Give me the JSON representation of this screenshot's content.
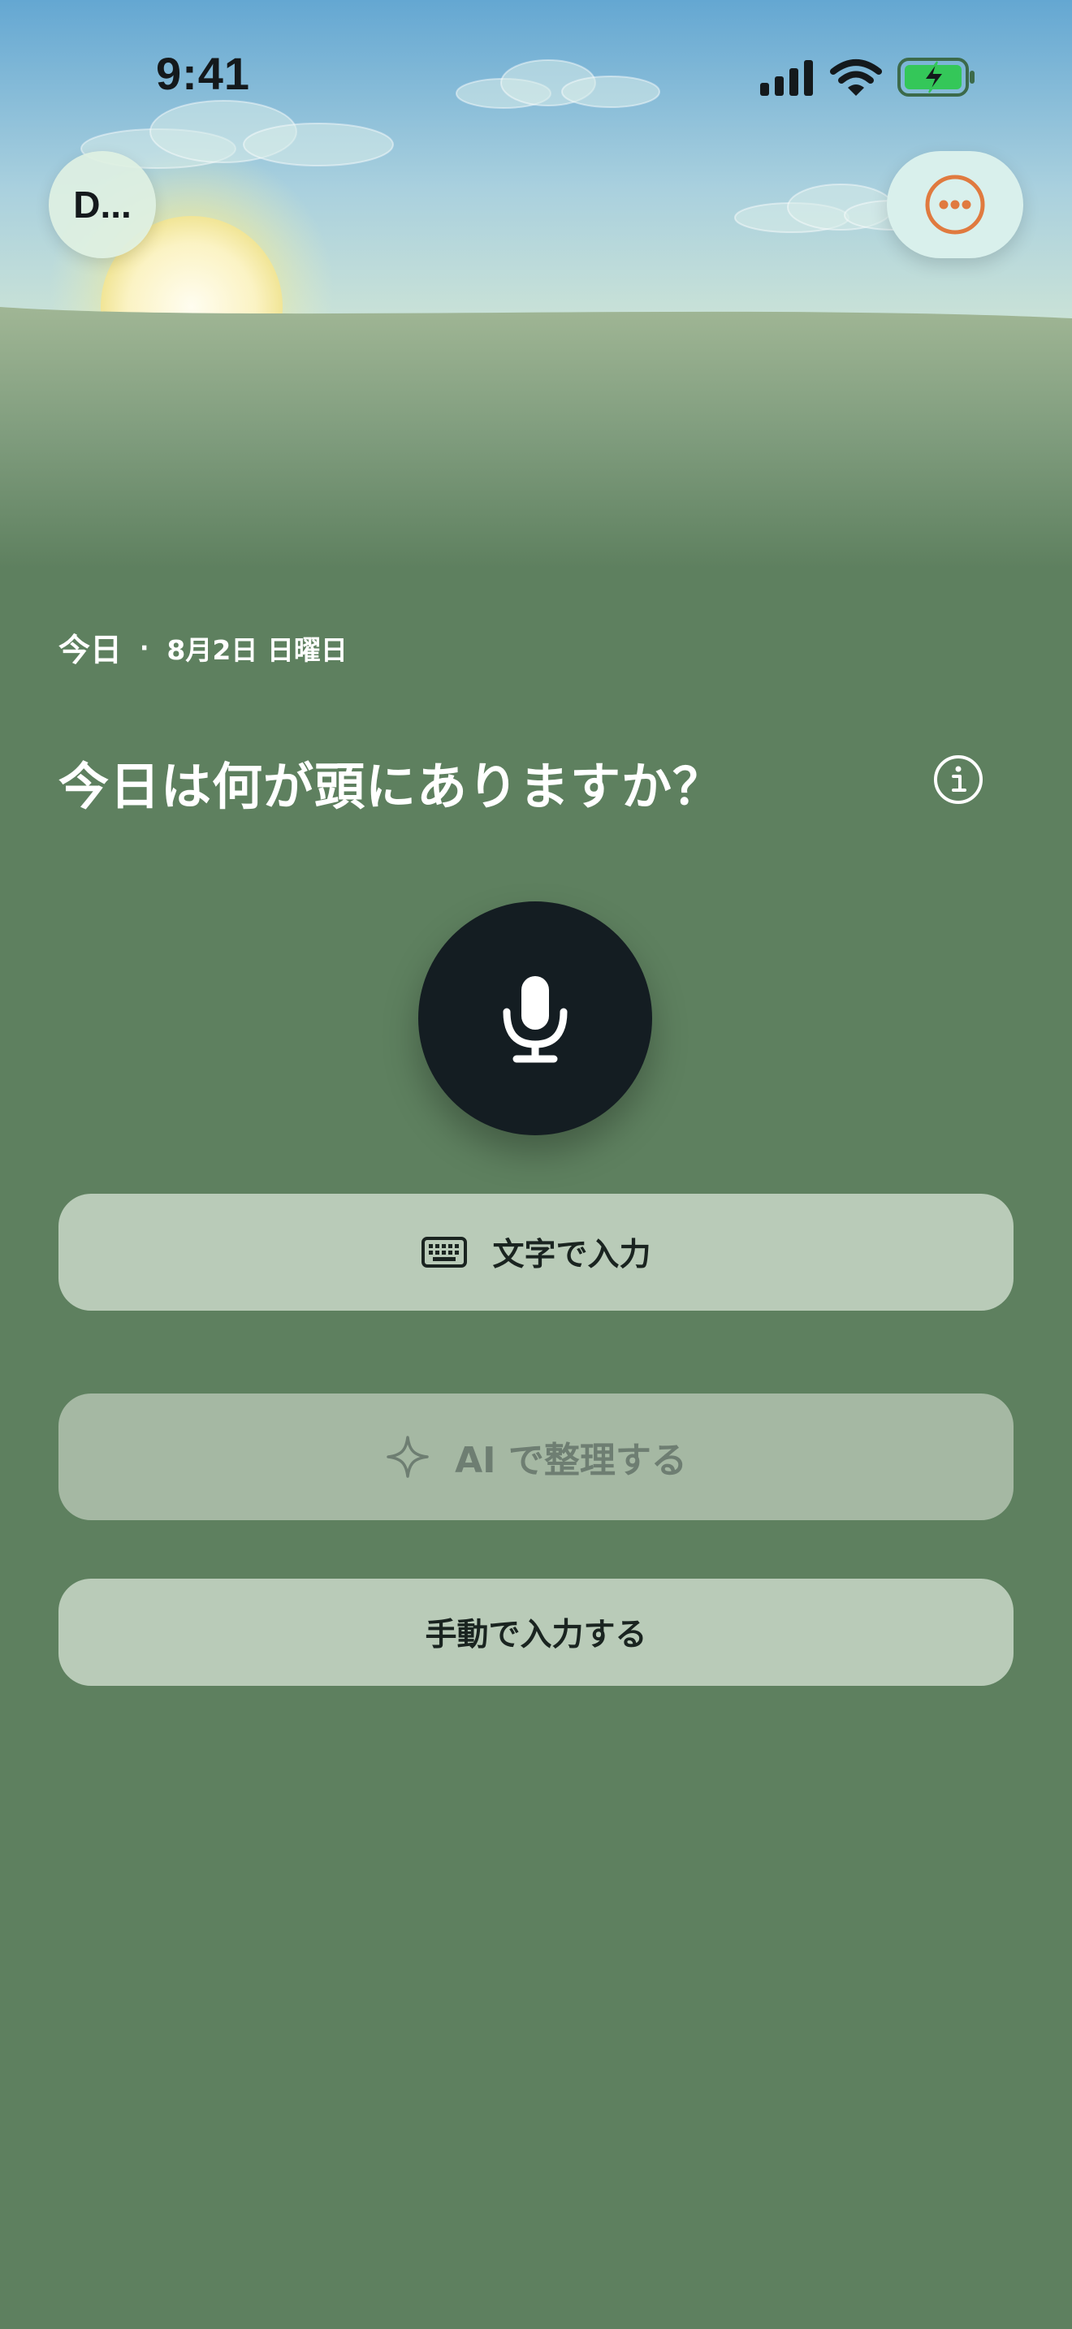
{
  "status_bar": {
    "time": "9:41",
    "icons": [
      "cellular-signal-icon",
      "wifi-icon",
      "battery-charging-icon"
    ],
    "battery_color": "#34c759"
  },
  "header": {
    "avatar_label": "D...",
    "more_icon": "ellipsis-circle-icon",
    "more_icon_color": "#e07a3f"
  },
  "date": {
    "today_label": "今日",
    "separator": "·",
    "full_date": "8月2日 日曜日"
  },
  "prompt": {
    "title": "今日は何が頭にありますか？",
    "info_icon": "info-circle-icon"
  },
  "mic": {
    "icon": "microphone-icon"
  },
  "actions": {
    "text_input": {
      "label": "文字で入力",
      "icon": "keyboard-icon"
    },
    "ai_organize": {
      "label": "AI で整理する",
      "icon": "sparkle-icon",
      "disabled": true
    },
    "manual_input": {
      "label": "手動で入力する"
    }
  },
  "colors": {
    "background": "#5e805f",
    "button": "#b9cbb8",
    "button_disabled": "#a5b8a3",
    "mic_button": "#141d22",
    "accent": "#e07a3f"
  }
}
